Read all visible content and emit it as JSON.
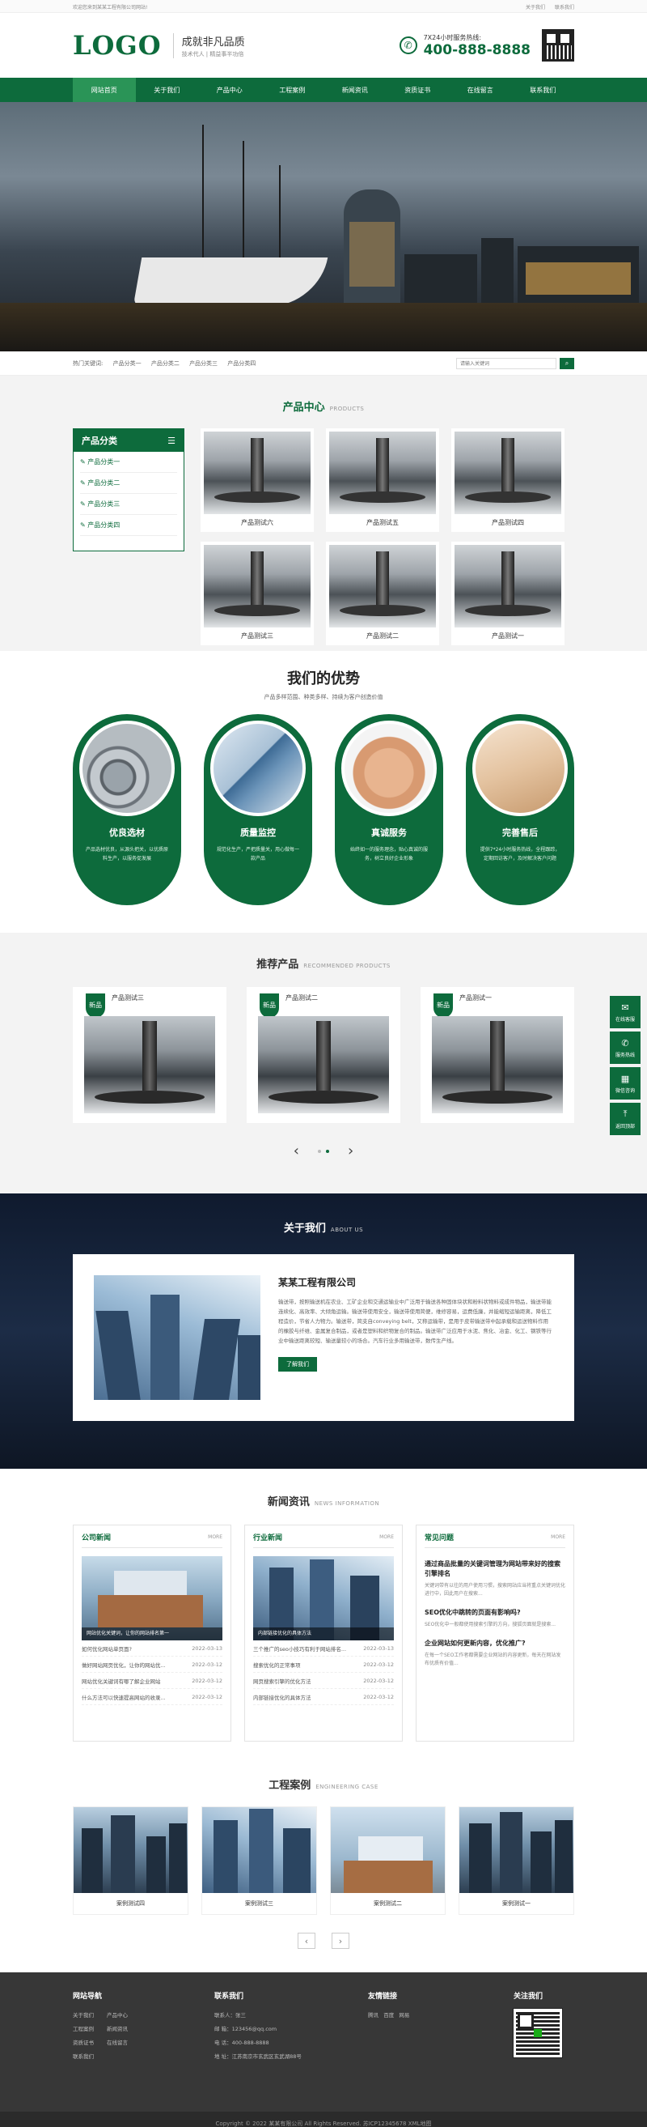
{
  "topbar": {
    "welcome": "欢迎您来到某某工程有限公司网站!",
    "links": [
      "关于我们",
      "联系我们"
    ]
  },
  "header": {
    "logo": "LOGO",
    "slogan_main": "成就非凡品质",
    "slogan_sub": "技术代人 | 精益事半功倍",
    "hotline_label": "7X24小时服务热线:",
    "hotline_number": "400-888-8888"
  },
  "nav": {
    "items": [
      "网站首页",
      "关于我们",
      "产品中心",
      "工程案例",
      "新闻资讯",
      "资质证书",
      "在线留言",
      "联系我们"
    ],
    "active": 0
  },
  "search": {
    "label": "热门关键词:",
    "keywords": [
      "产品分类一",
      "产品分类二",
      "产品分类三",
      "产品分类四"
    ],
    "placeholder": "请输入关键词",
    "button_icon": "search-icon"
  },
  "products": {
    "title": "产品中心",
    "title_en": "PRODUCTS",
    "category_title": "产品分类",
    "categories": [
      "产品分类一",
      "产品分类二",
      "产品分类三",
      "产品分类四"
    ],
    "items": [
      "产品测试六",
      "产品测试五",
      "产品测试四",
      "产品测试三",
      "产品测试二",
      "产品测试一"
    ]
  },
  "advantages": {
    "title": "我们的优势",
    "subtitle": "产品多样范围、种类多样、持续为客户创造价值",
    "cards": [
      {
        "title": "优良选材",
        "desc": "产品选材优良，从源头把关，以优质原料生产，以服务促发展"
      },
      {
        "title": "质量监控",
        "desc": "规范化生产，严把质量关，用心做每一款产品"
      },
      {
        "title": "真诚服务",
        "desc": "始终如一的服务理念，贴心真诚的服务，树立良好企业形象"
      },
      {
        "title": "完善售后",
        "desc": "提供7*24小时服务热线，全程跟踪，定期回访客户，及时解决客户问题"
      }
    ]
  },
  "recommended": {
    "title": "推荐产品",
    "title_en": "RECOMMENDED PRODUCTS",
    "tag": "新品",
    "items": [
      "产品测试三",
      "产品测试二",
      "产品测试一"
    ]
  },
  "about": {
    "title": "关于我们",
    "title_en": "ABOUT US",
    "company": "某某工程有限公司",
    "text": "输送带，按照输送机在农业、工矿企业和交通运输业中广泛用于输送各种固体块状和粉料状物料或成件物品，输送带能连续化、高效率、大倾角运输。输送带使用安全，输送带使用简便，维修容易，运费低廉，并能缩短运输距离，降低工程造价，节省人力物力。输送带，简支自conveying belt，又称运输带，是用于皮带输送带中起承载和运送物料作用的橡胶与纤维、金属复合制品，或者是塑料和织物复合的制品。输送带广泛应用于水泥、焦化、冶金、化工、钢铁等行业中输送距离较短、输送量较小的场合。汽车行业多用输送带，数传生产线。",
    "button": "了解我们"
  },
  "news": {
    "title": "新闻资讯",
    "title_en": "NEWS INFORMATION",
    "more": "MORE",
    "company": {
      "title": "公司新闻",
      "caption": "网站优化关键词，让你的网站排名第一",
      "items": [
        {
          "t": "如何优化网站单页面?",
          "d": "2022-03-13"
        },
        {
          "t": "做好网站网页优化，让你的网站优...",
          "d": "2022-03-12"
        },
        {
          "t": "网站优化关键词有哪了解企业网站",
          "d": "2022-03-12"
        },
        {
          "t": "什么方法可以快速提高网站的收录...",
          "d": "2022-03-12"
        }
      ]
    },
    "industry": {
      "title": "行业新闻",
      "caption": "内部链接优化的具体方法",
      "items": [
        {
          "t": "三个推广的seo小技巧有利于网站排名...",
          "d": "2022-03-13"
        },
        {
          "t": "搜索优化的正常事项",
          "d": "2022-03-12"
        },
        {
          "t": "网页搜索引擎的优化方法",
          "d": "2022-03-12"
        },
        {
          "t": "内部链接优化的具体方法",
          "d": "2022-03-12"
        }
      ]
    },
    "faq": {
      "title": "常见问题",
      "items": [
        {
          "q": "通过商品批量的关键词管理为网站带来好的搜索引擎排名",
          "a": "关键词带有以往的用户使用习惯，搜索网站应当将重点关键词优化进行中，因此用户在搜索..."
        },
        {
          "q": "SEO优化中跳转的页面有影响吗?",
          "a": "SEO优化中一般都使用搜索引擎的方向，搜狐页面就是搜索..."
        },
        {
          "q": "企业网站如何更新内容，优化推广?",
          "a": "在每一个SEO工作者都需要企业网站的内容更新，每天在网站发布优质有价值..."
        }
      ]
    }
  },
  "cases": {
    "title": "工程案例",
    "title_en": "ENGINEERING CASE",
    "items": [
      "案例测试四",
      "案例测试三",
      "案例测试二",
      "案例测试一"
    ]
  },
  "footer": {
    "nav_title": "网站导航",
    "nav_links": [
      "关于我们",
      "产品中心",
      "工程案例",
      "新闻资讯",
      "资质证书",
      "在线留言",
      "联系我们"
    ],
    "contact_title": "联系我们",
    "contact": [
      "联系人：张三",
      "邮  箱：123456@qq.com",
      "电  话：400-888-8888",
      "地  址：江苏南京市玄武区玄武湖88号"
    ],
    "friend_title": "友情链接",
    "friends": [
      "腾讯",
      "百度",
      "网易"
    ],
    "follow_title": "关注我们",
    "copyright": "Copyright © 2022 某某有限公司 All Rights Reserved.  苏ICP12345678 XML地图"
  },
  "float": {
    "items": [
      {
        "label": "在线客服",
        "icon": "chat-icon"
      },
      {
        "label": "服务热线",
        "icon": "phone-icon"
      },
      {
        "label": "微信咨询",
        "icon": "qr-icon"
      },
      {
        "label": "返回顶部",
        "icon": "arrow-up-icon"
      }
    ]
  },
  "colors": {
    "brand": "#0d6b3c",
    "footer": "#373737"
  }
}
